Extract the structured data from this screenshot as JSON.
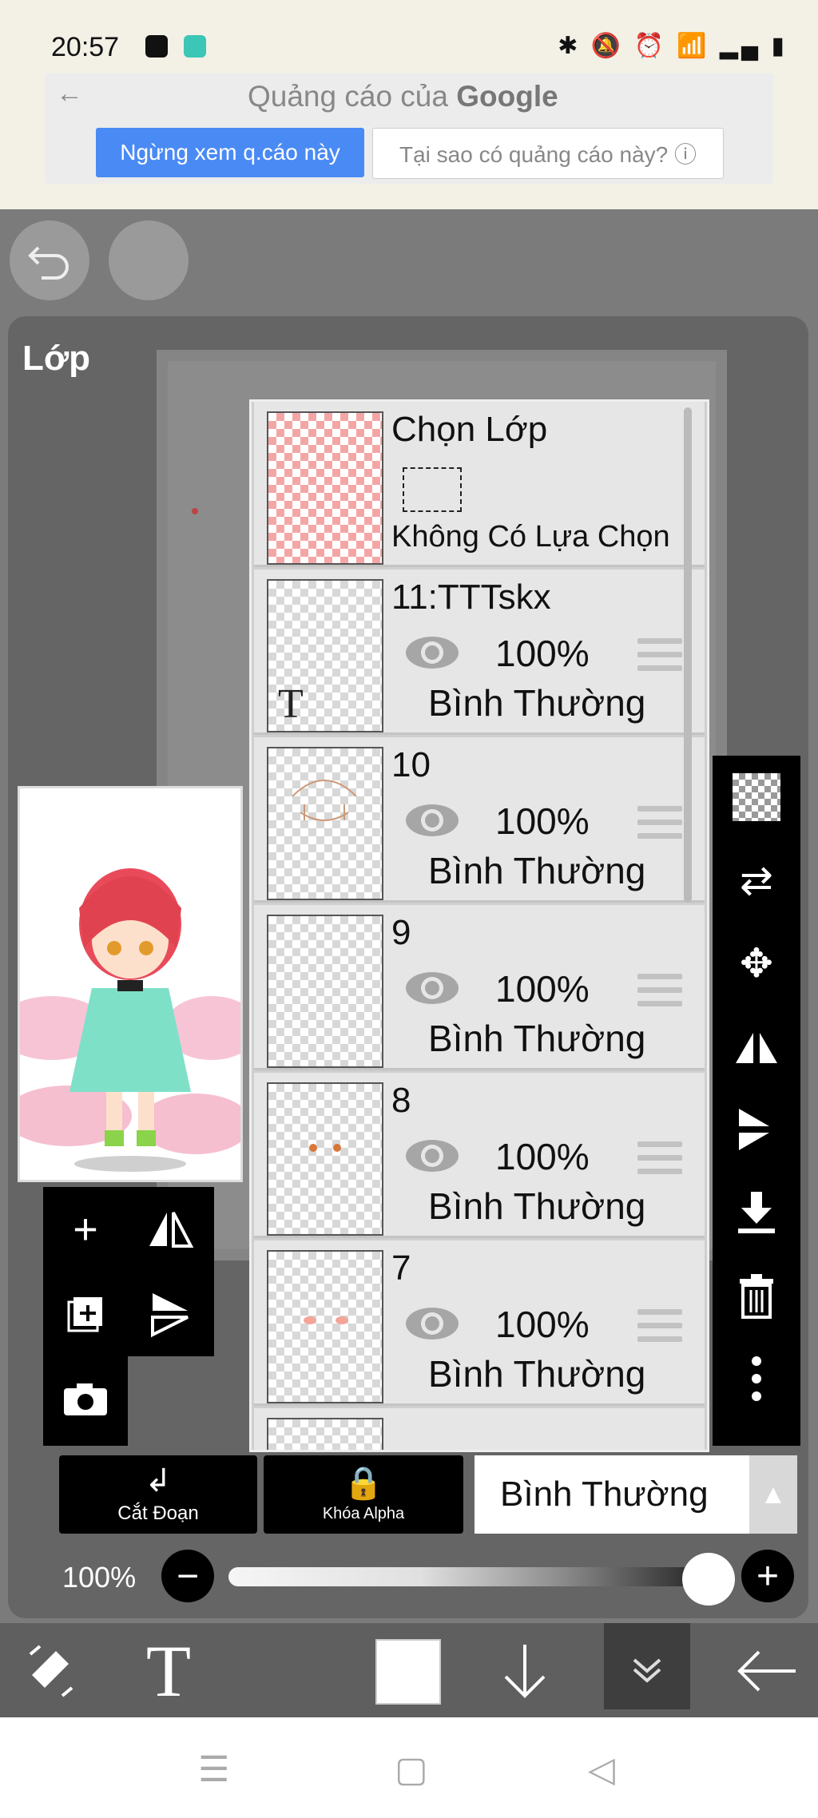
{
  "status": {
    "time": "20:57",
    "right": "✱ 🔕 ⏰ 📶 ▂▄ ▮"
  },
  "ad": {
    "title_prefix": "Quảng cáo của",
    "title_brand": "Google",
    "stop_label": "Ngừng xem q.cáo này",
    "why_label": "Tại sao có quảng cáo này? ⓘ"
  },
  "panel": {
    "title": "Lớp"
  },
  "selection_layer": {
    "title": "Chọn Lớp",
    "status": "Không Có Lựa Chọn"
  },
  "layers": [
    {
      "name": "11:TTTskx",
      "opacity": "100%",
      "blend": "Bình Thường",
      "thumb_label": "T"
    },
    {
      "name": "10",
      "opacity": "100%",
      "blend": "Bình Thường"
    },
    {
      "name": "9",
      "opacity": "100%",
      "blend": "Bình Thường"
    },
    {
      "name": "8",
      "opacity": "100%",
      "blend": "Bình Thường"
    },
    {
      "name": "7",
      "opacity": "100%",
      "blend": "Bình Thường"
    }
  ],
  "controls": {
    "clip_label": "Cắt Đoạn",
    "alpha_label": "Khóa Alpha",
    "blend_mode": "Bình Thường",
    "opacity_value": "100%"
  },
  "icons": {
    "undo": "undo-icon",
    "eye": "eye-icon",
    "trash": "trash-icon",
    "more": "more-icon"
  }
}
